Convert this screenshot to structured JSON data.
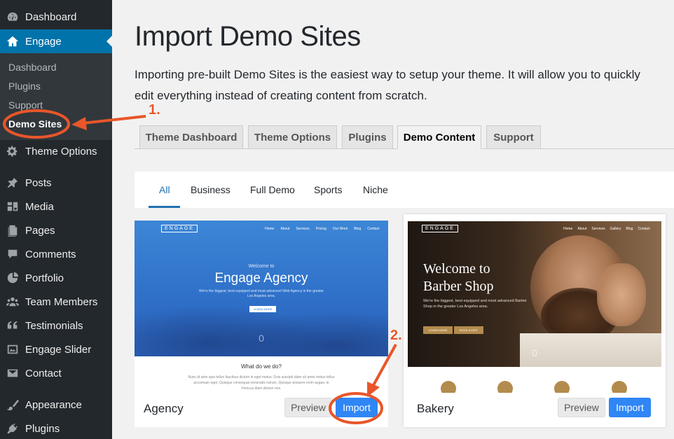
{
  "sidebar": {
    "items": [
      {
        "key": "dashboard",
        "label": "Dashboard",
        "icon": "dashboard-icon"
      },
      {
        "key": "engage",
        "label": "Engage",
        "icon": "home-icon",
        "active": true
      },
      {
        "key": "theme-options",
        "label": "Theme Options",
        "icon": "gear-icon"
      },
      {
        "key": "posts",
        "label": "Posts",
        "icon": "pin-icon"
      },
      {
        "key": "media",
        "label": "Media",
        "icon": "media-icon"
      },
      {
        "key": "pages",
        "label": "Pages",
        "icon": "pages-icon"
      },
      {
        "key": "comments",
        "label": "Comments",
        "icon": "comment-icon"
      },
      {
        "key": "portfolio",
        "label": "Portfolio",
        "icon": "portfolio-icon"
      },
      {
        "key": "team-members",
        "label": "Team Members",
        "icon": "team-icon"
      },
      {
        "key": "testimonials",
        "label": "Testimonials",
        "icon": "quote-icon"
      },
      {
        "key": "engage-slider",
        "label": "Engage Slider",
        "icon": "slider-icon"
      },
      {
        "key": "contact",
        "label": "Contact",
        "icon": "mail-icon"
      },
      {
        "key": "appearance",
        "label": "Appearance",
        "icon": "brush-icon"
      },
      {
        "key": "plugins",
        "label": "Plugins",
        "icon": "plug-icon"
      }
    ],
    "submenu": [
      {
        "label": "Dashboard"
      },
      {
        "label": "Plugins"
      },
      {
        "label": "Support"
      },
      {
        "label": "Demo Sites",
        "current": true
      }
    ]
  },
  "main": {
    "title": "Import Demo Sites",
    "intro": "Importing pre-built Demo Sites is the easiest way to setup your theme. It will allow you to quickly edit everything instead of creating content from scratch.",
    "tabs": [
      {
        "label": "Theme Dashboard"
      },
      {
        "label": "Theme Options"
      },
      {
        "label": "Plugins"
      },
      {
        "label": "Demo Content",
        "active": true
      },
      {
        "label": "Support"
      }
    ],
    "filters": [
      {
        "label": "All",
        "active": true
      },
      {
        "label": "Business"
      },
      {
        "label": "Full Demo"
      },
      {
        "label": "Sports"
      },
      {
        "label": "Niche"
      }
    ]
  },
  "demos": [
    {
      "name": "Agency",
      "preview_label": "Preview",
      "import_label": "Import",
      "thumb": {
        "logo": "ENGAGE",
        "nav": [
          "Home",
          "About",
          "Services",
          "Pricing",
          "Our Work",
          "Blog",
          "Contact"
        ],
        "welcome": "Welcome to",
        "title": "Engage Agency",
        "subtitle": "We're the biggest, best equipped and most advanced Web Agency in the greater Los Angeles area.",
        "button": "LEARN MORE",
        "counter": "0",
        "section_title": "What do we do?",
        "section_text": "Nunc id ante quis tellus faucibus dictum in eget metus. Duis suscipit diam sit amet metus tellus accumsan eget. Quisque consequat venenatis rutrum. Quisque posuere enim augue, in rhoncus diam dictum non."
      }
    },
    {
      "name": "Bakery",
      "preview_label": "Preview",
      "import_label": "Import",
      "thumb": {
        "logo": "ENGAGE",
        "nav": [
          "Home",
          "About",
          "Services",
          "Gallery",
          "Blog",
          "Contact"
        ],
        "title_line1": "Welcome to",
        "title_line2": "Barber Shop",
        "subtitle": "We're the biggest, best equipped and most advanced Barber Shop in the greater Los Angeles area.",
        "button1": "LEARN MORE",
        "button2": "BOOK A VISIT",
        "counter": "0"
      }
    }
  ],
  "annotations": [
    {
      "label": "1."
    },
    {
      "label": "2."
    }
  ],
  "colors": {
    "sidebar_bg": "#23282d",
    "active_menu": "#0073aa",
    "import_button": "#2f86f5",
    "annotation": "#e8562a"
  }
}
